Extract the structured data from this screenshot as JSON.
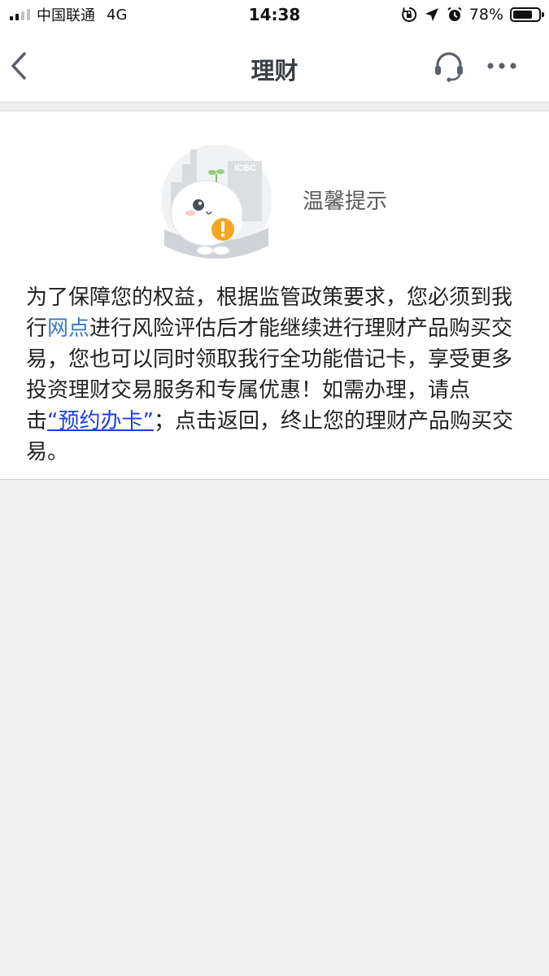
{
  "status_bar": {
    "carrier": "中国联通",
    "network": "4G",
    "time": "14:38",
    "battery_percent": "78%",
    "battery_level": 0.78,
    "icons": [
      "signal-icon",
      "orientation-lock-icon",
      "location-icon",
      "alarm-icon",
      "battery-icon"
    ]
  },
  "nav": {
    "title": "理财",
    "back_icon": "chevron-left-icon",
    "service_icon": "headset-icon",
    "more_icon": "more-icon"
  },
  "tip": {
    "title": "温馨提示",
    "mascot_label": "ICBC",
    "body": {
      "p1": "为了保障您的权益，根据监管政策要求，您必须到我行",
      "link_branch": "网点",
      "p2": "进行风险评估后才能继续进行理财产品购买交易，您也可以同时领取我行全功能借记卡，享受更多投资理财交易服务和专属优惠！如需办理，请点击",
      "link_appointment": "“预约办卡”",
      "p3": "；点击返回，终止您的理财产品购买交易。"
    }
  },
  "colors": {
    "background": "#efefef",
    "link": "#3a78c8",
    "underline_link": "#1a3fe8",
    "badge": "#f5a623"
  }
}
